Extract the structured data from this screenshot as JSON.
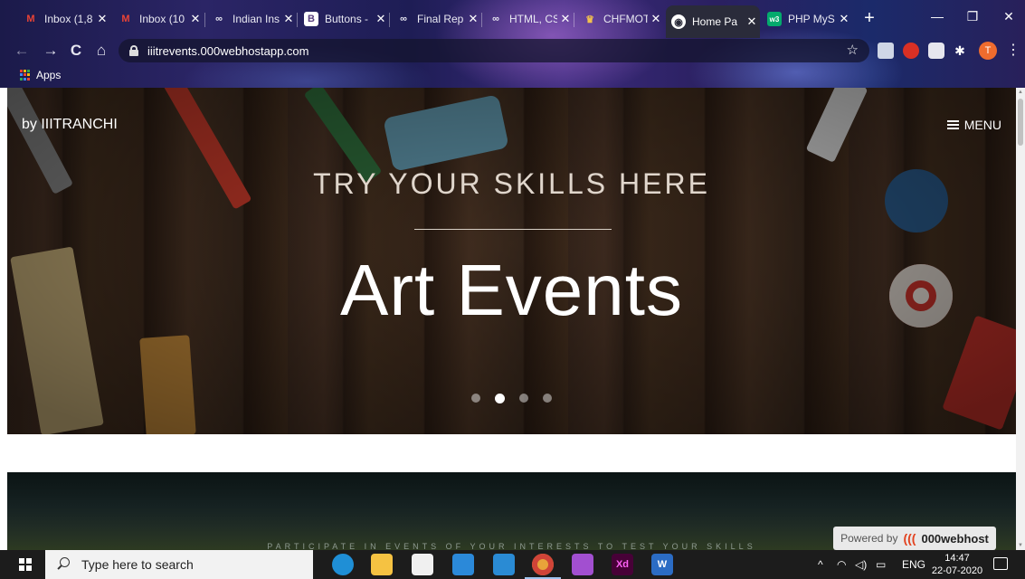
{
  "browser": {
    "tabs": [
      {
        "title": "Inbox (1,8",
        "favicon": "gmail-icon",
        "color": "#ea4335"
      },
      {
        "title": "Inbox (10",
        "favicon": "gmail-icon",
        "color": "#ea4335"
      },
      {
        "title": "Indian Ins",
        "favicon": "infinity-icon",
        "color": "#ffffff"
      },
      {
        "title": "Buttons -",
        "favicon": "bootstrap-icon",
        "color": "#ffffff"
      },
      {
        "title": "Final Rep",
        "favicon": "infinity-icon",
        "color": "#ffffff"
      },
      {
        "title": "HTML, CS",
        "favicon": "infinity-icon",
        "color": "#ffffff"
      },
      {
        "title": "CHFMOT",
        "favicon": "chef-icon",
        "color": "#f2c14e"
      },
      {
        "title": "Home Pa",
        "favicon": "globe-icon",
        "color": "#ffffff",
        "active": true
      },
      {
        "title": "PHP MyS",
        "favicon": "w3schools-icon",
        "color": "#04aa6d"
      }
    ],
    "new_tab": "+",
    "window_controls": {
      "minimize": "—",
      "maximize": "❐",
      "close": "✕"
    },
    "nav": {
      "back": "←",
      "forward": "→",
      "reload": "C",
      "home": "⌂"
    },
    "url": "iiitrevents.000webhostapp.com",
    "bookmark_star": "☆",
    "profile_initial": "T",
    "menu_glyph": "⋮",
    "bookmarks": {
      "apps_label": "Apps"
    }
  },
  "page": {
    "brand": "by IIITRANCHI",
    "menu_label": "MENU",
    "hero_kicker": "TRY YOUR SKILLS HERE",
    "hero_headline": "Art Events",
    "carousel": {
      "slides": 4,
      "active_index": 1
    },
    "section2_tagline": "PARTICIPATE IN EVENTS OF YOUR INTERESTS TO TEST YOUR SKILLS",
    "powered_prefix": "Powered by",
    "powered_brand": "000webhost"
  },
  "taskbar": {
    "search_placeholder": "Type here to search",
    "apps": [
      {
        "name": "edge-icon",
        "label": "",
        "color": "#1f8fd6"
      },
      {
        "name": "file-explorer-icon",
        "label": "",
        "color": "#f5c242"
      },
      {
        "name": "store-icon",
        "label": "",
        "color": "#f0f0f0"
      },
      {
        "name": "mail-icon",
        "label": "",
        "color": "#2b89d9"
      },
      {
        "name": "vscode-icon",
        "label": "",
        "color": "#2a8bd4"
      },
      {
        "name": "chrome-icon",
        "label": "",
        "color": "#e8a43a",
        "running": true
      },
      {
        "name": "whatsapp-icon",
        "label": "",
        "color": "#a24fd0"
      },
      {
        "name": "xd-icon",
        "label": "Xd",
        "color": "#470137"
      },
      {
        "name": "word-icon",
        "label": "W",
        "color": "#2b6cc4"
      }
    ],
    "tray": {
      "chevron": "^",
      "language": "ENG"
    },
    "time": "14:47",
    "date": "22-07-2020"
  }
}
